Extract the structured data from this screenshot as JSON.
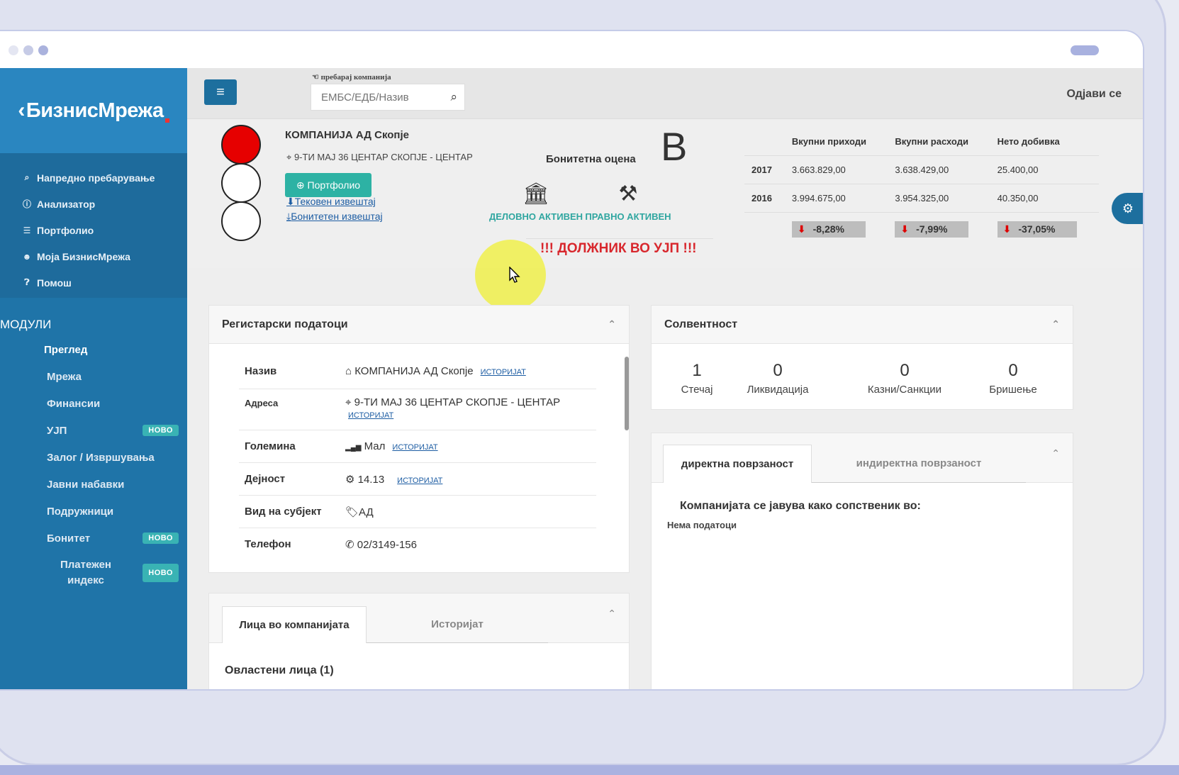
{
  "sidebar": {
    "logo": "БизнисМрежа",
    "nav": [
      {
        "icon": "search-icon",
        "glyph": "🔍︎",
        "label": "Напредно пребарување"
      },
      {
        "icon": "info-icon",
        "glyph": "ℹ",
        "label": "Анализатор"
      },
      {
        "icon": "list-icon",
        "glyph": "☰",
        "label": "Портфолио"
      },
      {
        "icon": "user-icon",
        "glyph": "☻",
        "label": "Моја БизнисМрежа"
      },
      {
        "icon": "help-icon",
        "glyph": "?",
        "label": "Помош"
      }
    ],
    "modules_title": "МОДУЛИ",
    "modules": [
      {
        "label": "Преглед",
        "badge": ""
      },
      {
        "label": "Мрежа",
        "badge": ""
      },
      {
        "label": "Финансии",
        "badge": ""
      },
      {
        "label": "УЈП",
        "badge": "НОВО"
      },
      {
        "label": "Залог / Извршувања",
        "badge": ""
      },
      {
        "label": "Јавни набавки",
        "badge": ""
      },
      {
        "label": "Подружници",
        "badge": ""
      },
      {
        "label": "Бонитет",
        "badge": "НОВО"
      },
      {
        "label": "Платежен индекс",
        "badge": "НОВО"
      }
    ]
  },
  "topbar": {
    "search_label": "пребарај компанија",
    "search_placeholder": "ЕМБС/ЕДБ/Назив",
    "logout": "Одјави се"
  },
  "company": {
    "name": "КОМПАНИЈА АД Скопје",
    "address": "9-ТИ МАЈ 36 ЦЕНТАР СКОПЈЕ - ЦЕНТАР",
    "portfolio_button": "Портфолио",
    "current_report": "Тековен извештај",
    "credit_report": "Бонитетен извештај",
    "rating_label": "Бонитетна оцена",
    "rating_value": "B",
    "status_business": "ДЕЛОВНО АКТИВЕН",
    "status_legal": "ПРАВНО АКТИВЕН",
    "debtor_warning": "!!! ДОЛЖНИК ВО УЈП !!!",
    "traffic_light": "red",
    "accent": "#2db2a4"
  },
  "financials": {
    "headers": [
      "",
      "Вкупни приходи",
      "Вкупни расходи",
      "Нето добивка"
    ],
    "rows": [
      {
        "year": "2017",
        "values": [
          "3.663.829,00",
          "3.638.429,00",
          "25.400,00"
        ]
      },
      {
        "year": "2016",
        "values": [
          "3.994.675,00",
          "3.954.325,00",
          "40.350,00"
        ]
      }
    ],
    "changes": [
      "-8,28%",
      "-7,99%",
      "-37,05%"
    ]
  },
  "registry": {
    "title": "Регистарски податоци",
    "history": "ИСТОРИЈАТ",
    "rows": [
      {
        "label": "Назив",
        "icon": "home-icon",
        "glyph": "⌂",
        "value": "КОМПАНИЈА АД Скопје",
        "hist": true
      },
      {
        "label": "Адреса",
        "icon": "map-marker-icon",
        "glyph": "⚲",
        "value": "9-ТИ МАЈ 36 ЦЕНТАР СКОПЈЕ - ЦЕНТАР",
        "hist": true
      },
      {
        "label": "Големина",
        "icon": "signal-icon",
        "glyph": "▂▄▆",
        "value": "Мал",
        "hist": true
      },
      {
        "label": "Дејност",
        "icon": "gear-icon",
        "glyph": "⚙",
        "value": "14.13",
        "hist": true
      },
      {
        "label": "Вид на субјект",
        "icon": "tags-icon",
        "glyph": "🏷︎",
        "value": "АД",
        "hist": false
      },
      {
        "label": "Телефон",
        "icon": "phone-icon",
        "glyph": "✆",
        "value": "02/3149-156",
        "hist": false
      }
    ]
  },
  "solvency": {
    "title": "Солвентност",
    "items": [
      {
        "num": "1",
        "label": "Стечај"
      },
      {
        "num": "0",
        "label": "Ликвидација"
      },
      {
        "num": "0",
        "label": "Казни/Санкции"
      },
      {
        "num": "0",
        "label": "Бришење"
      }
    ]
  },
  "relations": {
    "tab_direct": "директна поврзаност",
    "tab_indirect": "индиректна поврзаност",
    "heading": "Компанијата се јавува како сопственик во:",
    "empty": "Нема податоци"
  },
  "people": {
    "tab_people": "Лица во компанијата",
    "tab_history": "Историјат",
    "authorized": "Овластени лица (1)"
  }
}
